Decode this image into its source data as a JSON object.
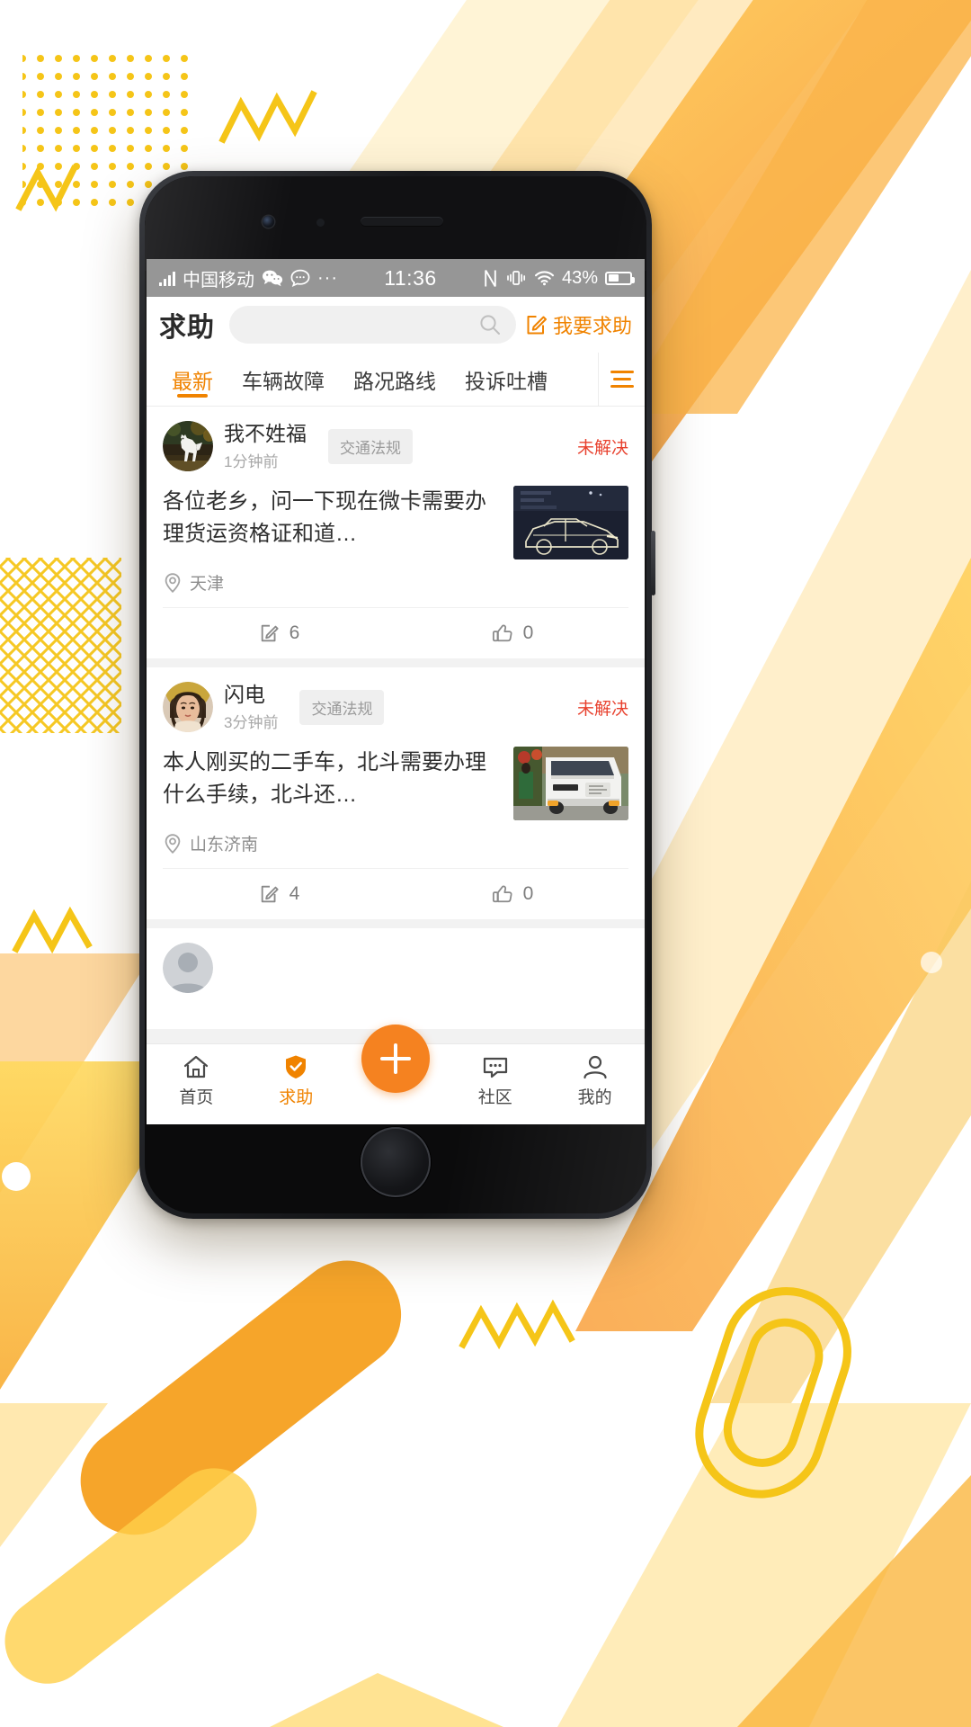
{
  "status_bar": {
    "carrier": "中国移动",
    "time": "11:36",
    "battery_percent": "43%",
    "icons": [
      "signal-bars-icon",
      "wechat-icon",
      "message-icon",
      "more-dots-icon",
      "nfc-icon",
      "vibrate-icon",
      "wifi-icon",
      "battery-icon"
    ]
  },
  "header": {
    "title": "求助",
    "search_placeholder": "",
    "search_value": "",
    "ask_label": "我要求助"
  },
  "tabs": {
    "items": [
      {
        "label": "最新",
        "active": true
      },
      {
        "label": "车辆故障",
        "active": false
      },
      {
        "label": "路况路线",
        "active": false
      },
      {
        "label": "投诉吐槽",
        "active": false
      }
    ],
    "filter_label": "筛选"
  },
  "feed": {
    "posts": [
      {
        "author": "我不姓福",
        "time": "1分钟前",
        "tag": "交通法规",
        "status": "未解决",
        "text": "各位老乡，问一下现在微卡需要办理货运资格证和道…",
        "location": "天津",
        "comments": "6",
        "likes": "0",
        "avatar_name": "avatar-white-horse",
        "thumb_name": "thumb-dark-car"
      },
      {
        "author": "闪电",
        "time": "3分钟前",
        "tag": "交通法规",
        "status": "未解决",
        "text": "本人刚买的二手车，北斗需要办理什么手续，北斗还…",
        "location": "山东济南",
        "comments": "4",
        "likes": "0",
        "avatar_name": "avatar-portrait-woman",
        "thumb_name": "thumb-white-truck"
      }
    ]
  },
  "bottom_nav": {
    "items": [
      {
        "label": "首页",
        "icon": "home-icon",
        "active": false
      },
      {
        "label": "求助",
        "icon": "shield-check-icon",
        "active": true
      },
      {
        "label": "社区",
        "icon": "chat-bubble-icon",
        "active": false
      },
      {
        "label": "我的",
        "icon": "person-icon",
        "active": false
      }
    ],
    "fab_label": "+"
  },
  "colors": {
    "accent": "#f08300",
    "fab": "#f58220",
    "status_red": "#e8412e",
    "bg_yellow": "#f7c71f",
    "bg_orange": "#f79433"
  }
}
